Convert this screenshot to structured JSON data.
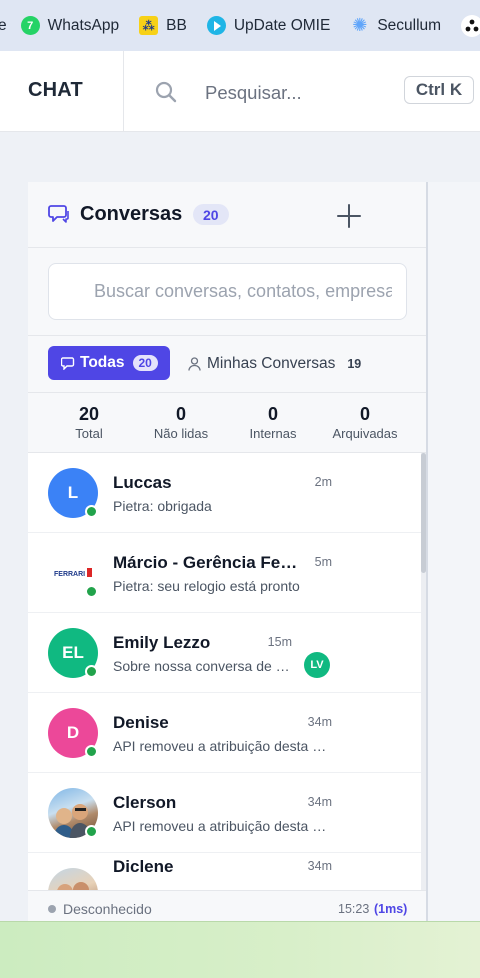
{
  "bookmarks": [
    {
      "label": "WhatsApp",
      "icon": "whatsapp-icon",
      "badge": "7"
    },
    {
      "label": "BB",
      "icon": "bb-icon",
      "badge": "BB"
    },
    {
      "label": "UpDate OMIE",
      "icon": "play-icon"
    },
    {
      "label": "Secullum",
      "icon": "secullum-icon"
    }
  ],
  "header": {
    "title": "CHAT",
    "search_placeholder": "Pesquisar...",
    "shortcut": "Ctrl K"
  },
  "conversations": {
    "title": "Conversas",
    "count": "20",
    "search_placeholder": "Buscar conversas, contatos, empresas...",
    "tabs": {
      "all_label": "Todas",
      "all_count": "20",
      "mine_label": "Minhas Conversas",
      "mine_count": "19"
    },
    "stats": [
      {
        "value": "20",
        "label": "Total"
      },
      {
        "value": "0",
        "label": "Não lidas"
      },
      {
        "value": "0",
        "label": "Internas"
      },
      {
        "value": "0",
        "label": "Arquivadas"
      }
    ],
    "items": [
      {
        "name": "Luccas",
        "initials": "L",
        "preview": "Pietra: obrigada",
        "time": "2m",
        "avatar_color": "#3b82f6"
      },
      {
        "name": "Márcio - Gerência Ferrari Relógios",
        "initials": "",
        "preview": "Pietra: seu relogio está pronto",
        "time": "5m",
        "avatar_logo": "FERRARI"
      },
      {
        "name": "Emily Lezzo",
        "initials": "EL",
        "preview": "Sobre nossa conversa de ontem",
        "time": "15m",
        "assignee": "LV",
        "avatar_color": "#10b981"
      },
      {
        "name": "Denise",
        "initials": "D",
        "preview": "API removeu a atribuição desta conversa",
        "time": "34m",
        "avatar_color": "#ec4899"
      },
      {
        "name": "Clerson",
        "initials": "",
        "preview": "API removeu a atribuição desta conversa",
        "time": "34m"
      },
      {
        "name": "Diclene",
        "initials": "",
        "preview": "",
        "time": "34m"
      }
    ]
  },
  "footer": {
    "status": "Desconhecido",
    "time": "15:23",
    "latency": "(1ms)"
  },
  "colors": {
    "accent": "#4f46e5",
    "online": "#22a34b"
  }
}
